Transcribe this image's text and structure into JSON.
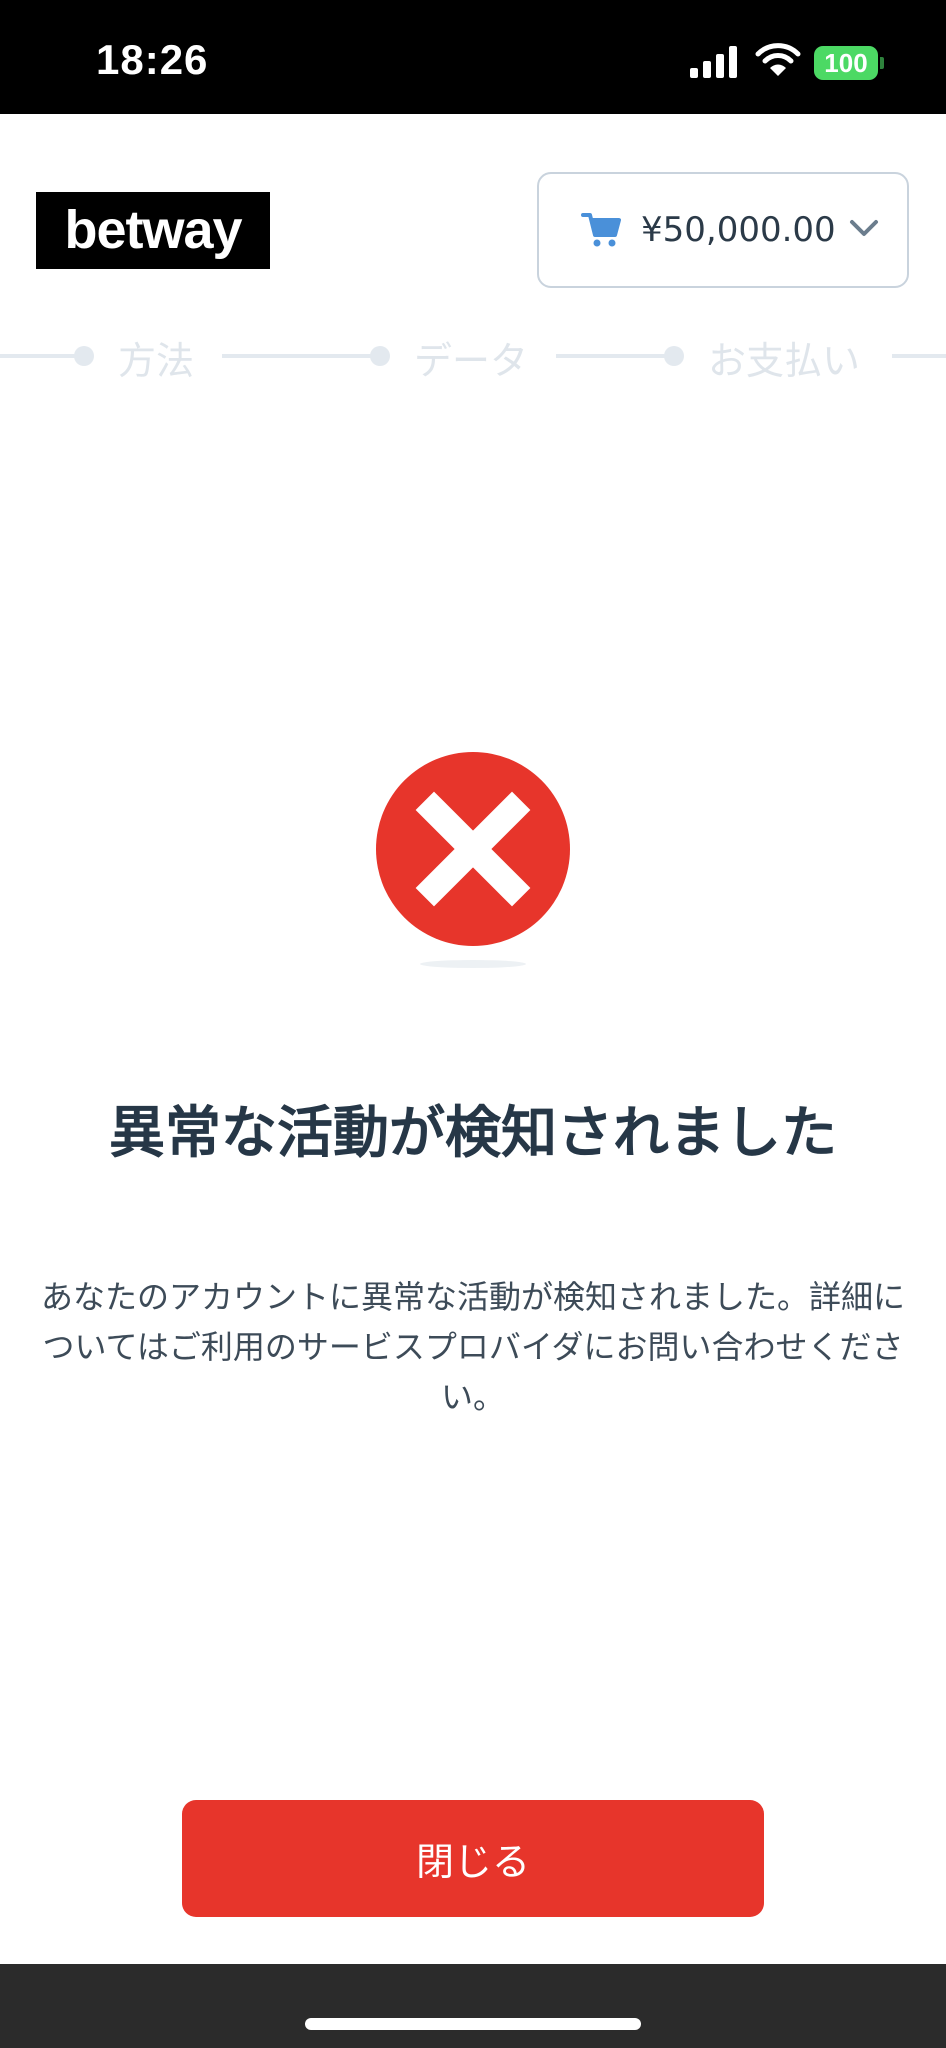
{
  "status_bar": {
    "time": "18:26",
    "battery": "100",
    "icons": [
      "signal-icon",
      "wifi-icon",
      "battery-icon"
    ]
  },
  "header": {
    "logo_text": "betway",
    "amount": "¥50,000.00",
    "icons": [
      "cart-icon",
      "chevron-down-icon"
    ]
  },
  "stepper": {
    "steps": [
      {
        "label": "方法"
      },
      {
        "label": "データ"
      },
      {
        "label": "お支払い"
      }
    ]
  },
  "result": {
    "icon": "error-x-icon",
    "title": "異常な活動が検知されました",
    "description": "あなたのアカウントに異常な活動が検知されました。詳細についてはご利用のサービスプロバイダにお問い合わせください。"
  },
  "actions": {
    "close_label": "閉じる"
  },
  "colors": {
    "accent": "#e7352b",
    "title": "#263747",
    "status_bar": "#000000",
    "battery": "#4cd964"
  }
}
